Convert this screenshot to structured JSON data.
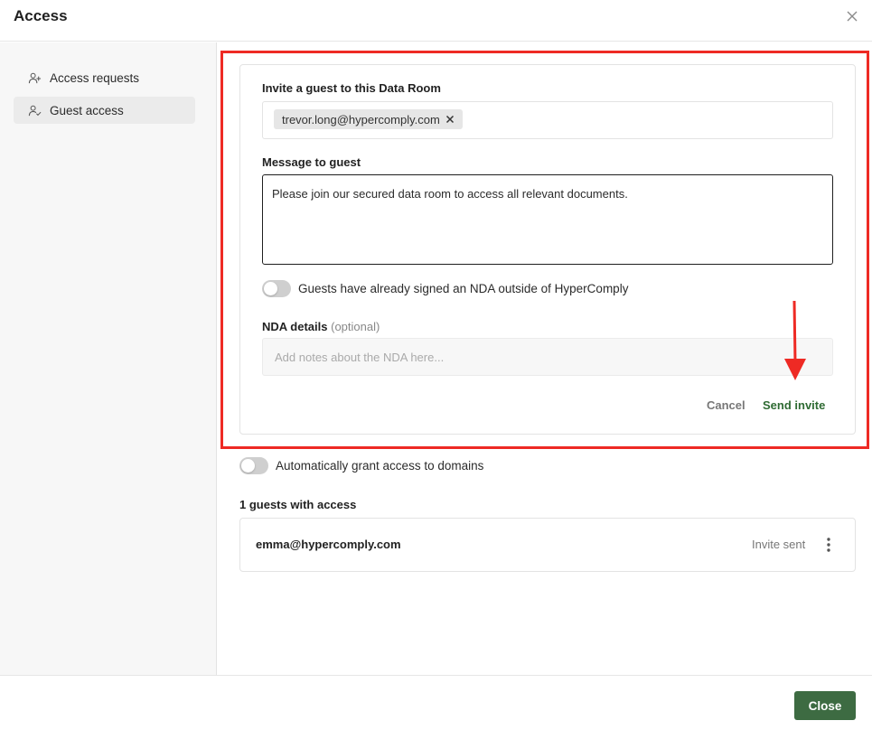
{
  "header": {
    "title": "Access"
  },
  "sidebar": {
    "items": [
      {
        "label": "Access requests",
        "icon": "user-plus-icon"
      },
      {
        "label": "Guest access",
        "icon": "user-check-icon"
      }
    ]
  },
  "invite_form": {
    "invite_label": "Invite a guest to this Data Room",
    "guest_chip": "trevor.long@hypercomply.com",
    "message_label": "Message to guest",
    "message_value": "Please join our secured data room to access all relevant documents.",
    "nda_toggle_label": "Guests have already signed an NDA outside of HyperComply",
    "nda_details_label": "NDA details",
    "nda_details_optional": "(optional)",
    "nda_placeholder": "Add notes about the NDA here...",
    "cancel_label": "Cancel",
    "send_label": "Send invite"
  },
  "domains_toggle_label": "Automatically grant access to domains",
  "guests": {
    "heading": "1 guests with access",
    "rows": [
      {
        "email": "emma@hypercomply.com",
        "status": "Invite sent"
      }
    ]
  },
  "footer": {
    "close_label": "Close"
  },
  "colors": {
    "accent_green": "#3d6b42",
    "send_green": "#2f6b33",
    "annotation_red": "#ee2a24"
  }
}
